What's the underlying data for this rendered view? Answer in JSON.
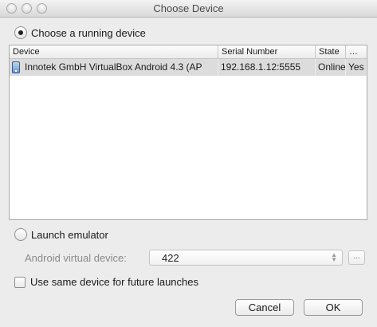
{
  "window": {
    "title": "Choose Device"
  },
  "running": {
    "label": "Choose a running device",
    "selected": true
  },
  "table": {
    "columns": [
      "Device",
      "Serial Number",
      "State",
      "…"
    ],
    "rows": [
      {
        "device": "Innotek GmbH VirtualBox Android 4.3 (AP",
        "serial": "192.168.1.12:5555",
        "state": "Online",
        "extra": "Yes"
      }
    ]
  },
  "emulator": {
    "label": "Launch emulator",
    "selected": false,
    "avd_label": "Android virtual device:",
    "avd_value": "422",
    "browse_label": "..."
  },
  "same_device": {
    "label": "Use same device for future launches",
    "checked": false
  },
  "buttons": {
    "cancel": "Cancel",
    "ok": "OK"
  },
  "icons": {
    "device": "android-device-icon",
    "select_arrows": "up-down-arrows-icon"
  }
}
